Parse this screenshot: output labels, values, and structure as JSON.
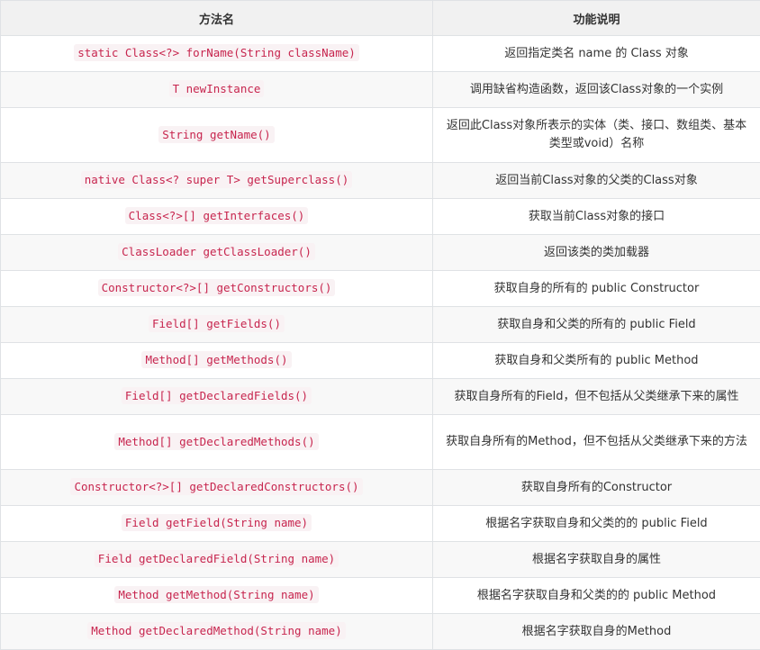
{
  "header": {
    "col_method": "方法名",
    "col_desc": "功能说明"
  },
  "rows": [
    {
      "method": "static Class<?> forName(String className)",
      "desc": "返回指定类名 name 的 Class 对象"
    },
    {
      "method": "T newInstance",
      "desc": "调用缺省构造函数，返回该Class对象的一个实例"
    },
    {
      "method": "String getName()",
      "desc": "返回此Class对象所表示的实体（类、接口、数组类、基本类型或void）名称"
    },
    {
      "method": "native Class<? super T> getSuperclass()",
      "desc": "返回当前Class对象的父类的Class对象"
    },
    {
      "method": "Class<?>[] getInterfaces()",
      "desc": "获取当前Class对象的接口"
    },
    {
      "method": "ClassLoader getClassLoader()",
      "desc": "返回该类的类加载器"
    },
    {
      "method": "Constructor<?>[] getConstructors()",
      "desc": "获取自身的所有的 public Constructor"
    },
    {
      "method": "Field[] getFields()",
      "desc": "获取自身和父类的所有的 public Field"
    },
    {
      "method": "Method[] getMethods()",
      "desc": "获取自身和父类所有的 public Method"
    },
    {
      "method": "Field[] getDeclaredFields()",
      "desc": "获取自身所有的Field，但不包括从父类继承下来的属性"
    },
    {
      "method": "Method[] getDeclaredMethods()",
      "desc": "获取自身所有的Method，但不包括从父类继承下来的方法"
    },
    {
      "method": "Constructor<?>[] getDeclaredConstructors()",
      "desc": "获取自身所有的Constructor"
    },
    {
      "method": "Field getField(String name)",
      "desc": "根据名字获取自身和父类的的 public Field"
    },
    {
      "method": "Field getDeclaredField(String name)",
      "desc": "根据名字获取自身的属性"
    },
    {
      "method": "Method getMethod(String name)",
      "desc": "根据名字获取自身和父类的的 public Method"
    },
    {
      "method": "Method getDeclaredMethod(String name)",
      "desc": "根据名字获取自身的Method"
    }
  ]
}
